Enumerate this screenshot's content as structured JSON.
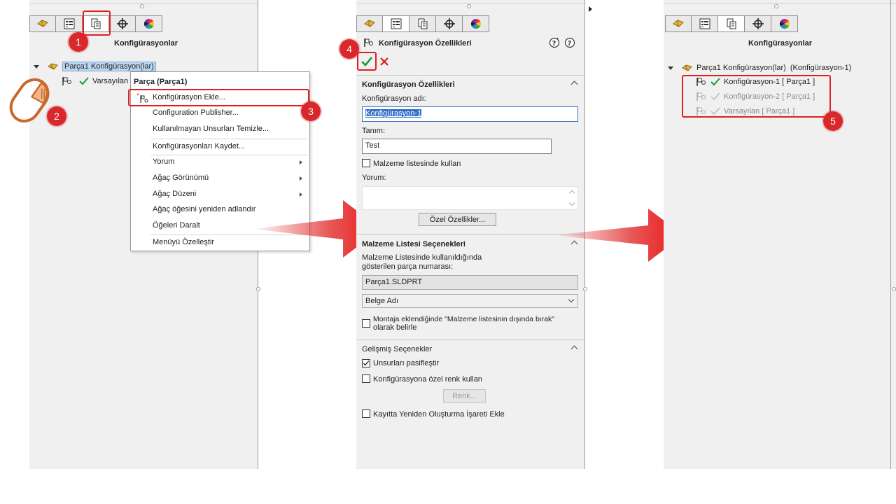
{
  "colors": {
    "accent_red": "#e02020",
    "callout_red": "#d9282b",
    "check_green": "#1a9a3a",
    "select_blue": "#bcd7f1"
  },
  "panel1": {
    "title": "Konfigürasyonlar",
    "tree_root": "Parça1 Konfigürasyon(lar)",
    "tree_child": "Varsayılan",
    "callouts": [
      "1",
      "2",
      "3"
    ],
    "context_menu": {
      "header": "Parça (Parça1)",
      "items": [
        "Konfigürasyon Ekle...",
        "Configuration Publisher...",
        "Kullanılmayan Unsurları Temizle...",
        "Konfigürasyonları Kaydet...",
        "Yorum",
        "Ağaç Görünümü",
        "Ağaç Düzeni",
        "Ağaç öğesini yeniden adlandır",
        "Öğeleri Daralt",
        "Menüyü Özelleştir"
      ]
    }
  },
  "panel2": {
    "title": "Konfigürasyon Özellikleri",
    "callout": "4",
    "section1": {
      "heading": "Konfigürasyon Özellikleri",
      "name_label": "Konfigürasyon adı:",
      "name_value": "Konfigürasyon-1",
      "desc_label": "Tanım:",
      "desc_value": "Test",
      "bom_checkbox": "Malzeme listesinde kullan",
      "comment_label": "Yorum:",
      "custom_props_button": "Özel Özellikler..."
    },
    "section2": {
      "heading": "Malzeme Listesi Seçenekleri",
      "desc_line1": "Malzeme Listesinde kullanıldığında",
      "desc_line2": "gösterilen parça numarası:",
      "part_number": "Parça1.SLDPRT",
      "dropdown_value": "Belge Adı",
      "exclude_line1": "Montaja eklendiğinde \"Malzeme listesinin dışında bırak\"",
      "exclude_line2": "olarak belirle"
    },
    "section3": {
      "heading": "Gelişmiş Seçenekler",
      "suppress_features": "Unsurları pasifleştir",
      "config_color": "Konfigürasyona özel renk kullan",
      "color_button": "Renk...",
      "rebuild_mark": "Kayıtta Yeniden Oluşturma İşareti Ekle"
    }
  },
  "panel3": {
    "title": "Konfigürasyonlar",
    "tree_root": "Parça1 Konfigürasyon(lar)  (Konfigürasyon-1)",
    "items": [
      "Konfigürasyon-1 [ Parça1 ]",
      "Konfigürasyon-2 [ Parça1 ]",
      "Varsayılan [ Parça1 ]"
    ],
    "callout": "5"
  }
}
